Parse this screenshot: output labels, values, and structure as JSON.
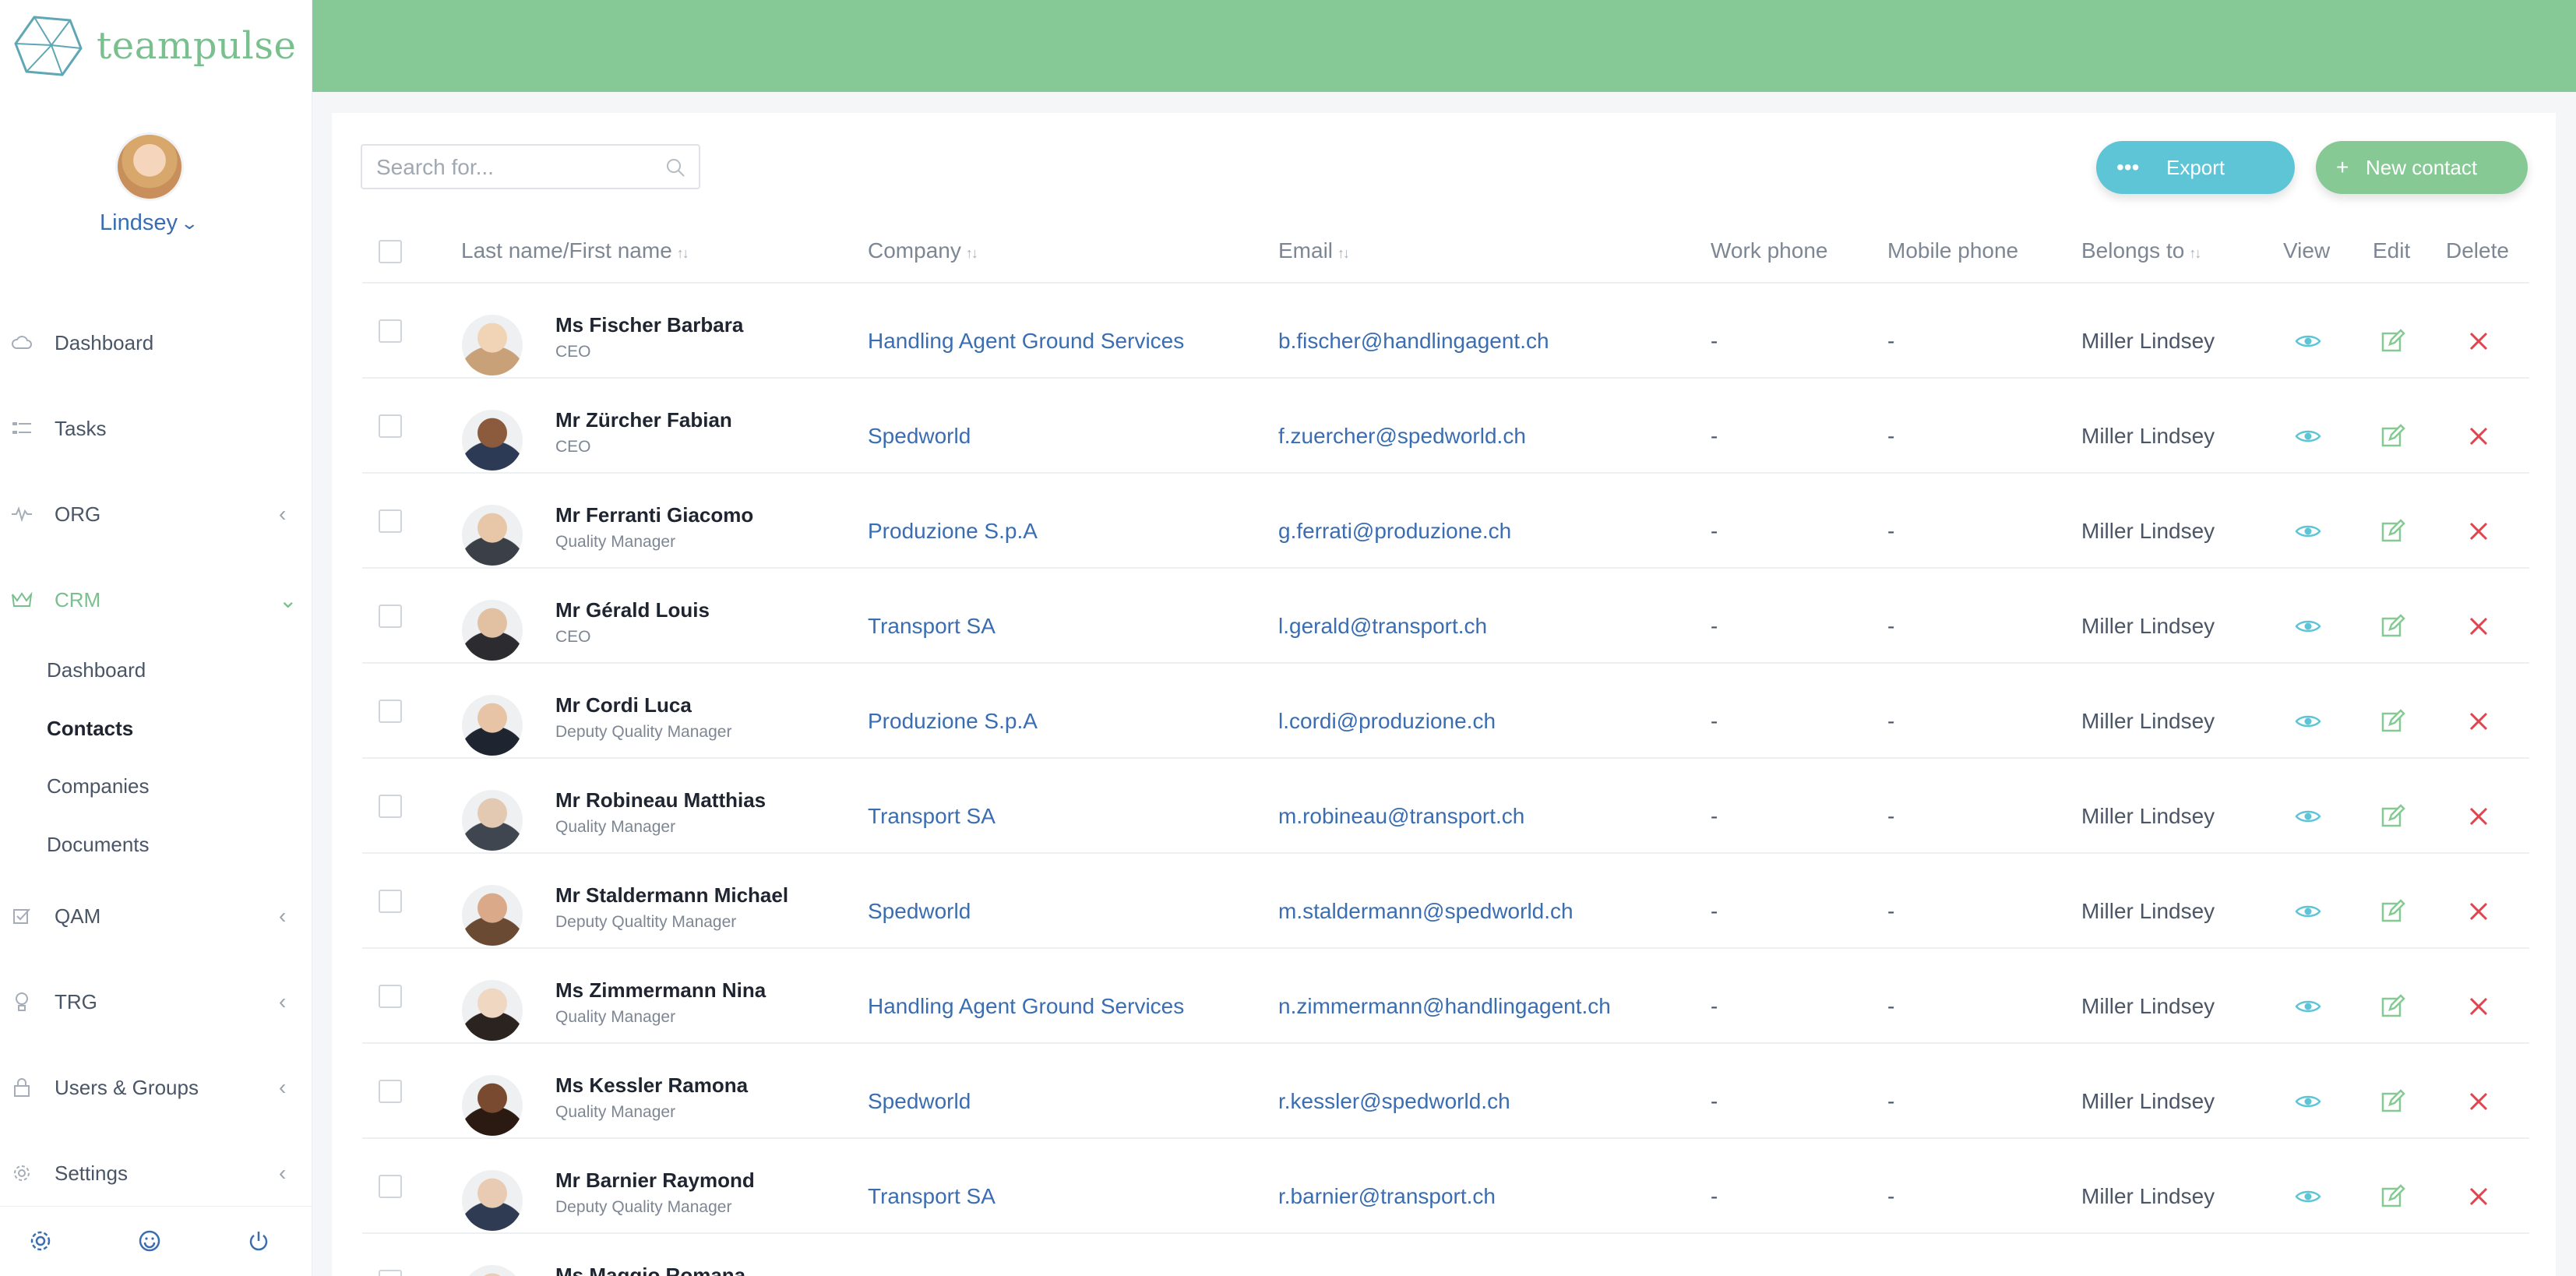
{
  "brand": {
    "name": "teampulse",
    "accent": "#7ac08f",
    "link": "#3a6db1"
  },
  "user": {
    "name": "Lindsey"
  },
  "nav": {
    "dashboard": "Dashboard",
    "tasks": "Tasks",
    "org": "ORG",
    "crm": "CRM",
    "crm_sub": [
      "Dashboard",
      "Contacts",
      "Companies",
      "Documents"
    ],
    "qam": "QAM",
    "trg": "TRG",
    "users_groups": "Users & Groups",
    "settings": "Settings"
  },
  "toolbar": {
    "search_placeholder": "Search for...",
    "export_label": "Export",
    "new_contact_label": "New contact"
  },
  "table": {
    "columns": {
      "name": "Last name/First name",
      "company": "Company",
      "email": "Email",
      "work_phone": "Work phone",
      "mobile_phone": "Mobile phone",
      "belongs_to": "Belongs to",
      "view": "View",
      "edit": "Edit",
      "delete": "Delete"
    },
    "rows": [
      {
        "name": "Ms Fischer Barbara",
        "title": "CEO",
        "company": "Handling Agent Ground Services",
        "email": "b.fischer@handlingagent.ch",
        "work": "-",
        "mobile": "-",
        "owner": "Miller Lindsey"
      },
      {
        "name": "Mr Zürcher Fabian",
        "title": "CEO",
        "company": "Spedworld",
        "email": "f.zuercher@spedworld.ch",
        "work": "-",
        "mobile": "-",
        "owner": "Miller Lindsey"
      },
      {
        "name": "Mr Ferranti Giacomo",
        "title": "Quality Manager",
        "company": "Produzione S.p.A",
        "email": "g.ferrati@produzione.ch",
        "work": "-",
        "mobile": "-",
        "owner": "Miller Lindsey"
      },
      {
        "name": "Mr Gérald Louis",
        "title": "CEO",
        "company": "Transport SA",
        "email": "l.gerald@transport.ch",
        "work": "-",
        "mobile": "-",
        "owner": "Miller Lindsey"
      },
      {
        "name": "Mr Cordi Luca",
        "title": "Deputy Quality Manager",
        "company": "Produzione S.p.A",
        "email": "l.cordi@produzione.ch",
        "work": "-",
        "mobile": "-",
        "owner": "Miller Lindsey"
      },
      {
        "name": "Mr Robineau Matthias",
        "title": "Quality Manager",
        "company": "Transport SA",
        "email": "m.robineau@transport.ch",
        "work": "-",
        "mobile": "-",
        "owner": "Miller Lindsey"
      },
      {
        "name": "Mr Staldermann Michael",
        "title": "Deputy Qualtity Manager",
        "company": "Spedworld",
        "email": "m.staldermann@spedworld.ch",
        "work": "-",
        "mobile": "-",
        "owner": "Miller Lindsey"
      },
      {
        "name": "Ms Zimmermann Nina",
        "title": "Quality Manager",
        "company": "Handling Agent Ground Services",
        "email": "n.zimmermann@handlingagent.ch",
        "work": "-",
        "mobile": "-",
        "owner": "Miller Lindsey"
      },
      {
        "name": "Ms Kessler Ramona",
        "title": "Quality Manager",
        "company": "Spedworld",
        "email": "r.kessler@spedworld.ch",
        "work": "-",
        "mobile": "-",
        "owner": "Miller Lindsey"
      },
      {
        "name": "Mr Barnier Raymond",
        "title": "Deputy Quality Manager",
        "company": "Transport SA",
        "email": "r.barnier@transport.ch",
        "work": "-",
        "mobile": "-",
        "owner": "Miller Lindsey"
      },
      {
        "name": "Ms Maggio Romana",
        "title": "",
        "company": "",
        "email": "",
        "work": "",
        "mobile": "",
        "owner": ""
      }
    ]
  }
}
